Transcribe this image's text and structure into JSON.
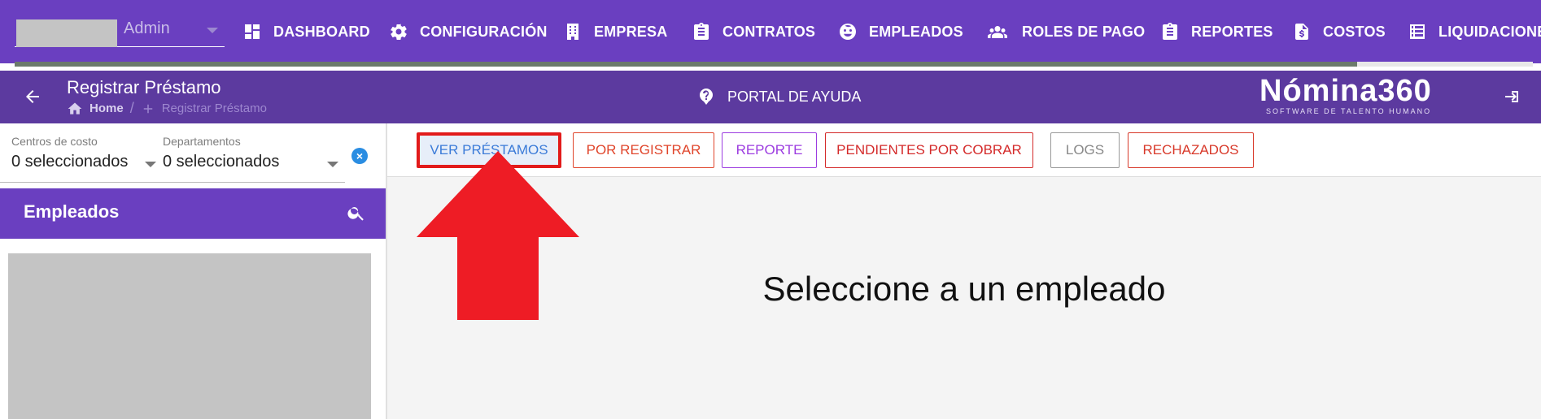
{
  "colors": {
    "primary": "#6a3fc0",
    "subbar": "#5c3a9f",
    "ver_prestamos": "#3b7bd8",
    "por_registrar": "#e0452b",
    "reporte": "#9c3ce0",
    "pendientes": "#d42a2a",
    "logs": "#888888",
    "rechazados": "#d8392a",
    "arrow": "#ee1c25"
  },
  "user": {
    "name": "Admin"
  },
  "nav": [
    {
      "label": "DASHBOARD",
      "icon": "dashboard-icon"
    },
    {
      "label": "CONFIGURACIÓN",
      "icon": "gear-icon"
    },
    {
      "label": "EMPRESA",
      "icon": "building-icon"
    },
    {
      "label": "CONTRATOS",
      "icon": "clipboard-icon"
    },
    {
      "label": "EMPLEADOS",
      "icon": "face-icon"
    },
    {
      "label": "ROLES DE PAGO",
      "icon": "people-icon"
    },
    {
      "label": "REPORTES",
      "icon": "clipboard-icon"
    },
    {
      "label": "COSTOS",
      "icon": "dollar-file-icon"
    },
    {
      "label": "LIQUIDACIONE",
      "icon": "list-icon"
    }
  ],
  "header": {
    "title": "Registrar Préstamo",
    "breadcrumb_home": "Home",
    "breadcrumb_sep": "/",
    "breadcrumb_current": "Registrar Préstamo",
    "help_label": "PORTAL DE AYUDA",
    "logo_main": "Nómina360",
    "logo_sub": "SOFTWARE DE TALENTO HUMANO"
  },
  "filters": {
    "centros_label": "Centros de costo",
    "centros_value": "0 seleccionados",
    "departamentos_label": "Departamentos",
    "departamentos_value": "0 seleccionados",
    "clear_symbol": "×"
  },
  "employees": {
    "title": "Empleados"
  },
  "tabs": {
    "ver_prestamos": "VER PRÉSTAMOS",
    "por_registrar": "POR REGISTRAR",
    "reporte": "REPORTE",
    "pendientes": "PENDIENTES POR COBRAR",
    "logs": "LOGS",
    "rechazados": "RECHAZADOS"
  },
  "main": {
    "message": "Seleccione a un empleado"
  }
}
